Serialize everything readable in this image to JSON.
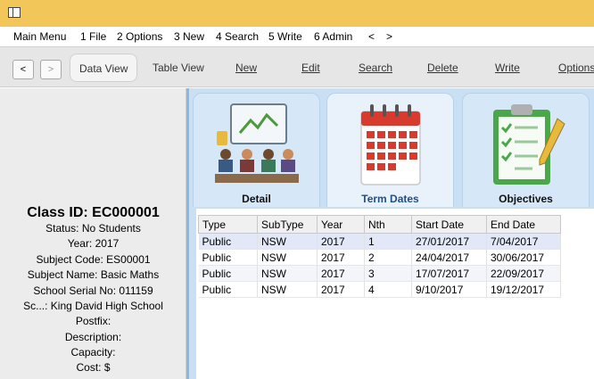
{
  "menu": {
    "items": [
      "Main Menu",
      "1 File",
      "2 Options",
      "3 New",
      "4 Search",
      "5 Write",
      "6 Admin",
      "<",
      ">"
    ]
  },
  "toolbar": {
    "back_label": "<",
    "forward_label": ">",
    "buttons": [
      "Data View",
      "Table View",
      "New",
      "Edit",
      "Search",
      "Delete",
      "Write",
      "Options"
    ]
  },
  "record": {
    "class_id": "Class ID: EC000001",
    "lines": [
      "Status: No Students",
      "Year: 2017",
      "Subject Code: ES00001",
      "Subject Name: Basic Maths",
      "School Serial No: 011159",
      "Sc...: King David High School",
      "Postfix:",
      "Description:",
      "Capacity:",
      "Cost: $"
    ]
  },
  "tiles": [
    {
      "label": "Detail",
      "icon": "presentation-icon"
    },
    {
      "label": "Term Dates",
      "icon": "calendar-icon"
    },
    {
      "label": "Objectives",
      "icon": "clipboard-checklist-icon"
    }
  ],
  "table": {
    "headers": [
      "Type",
      "SubType",
      "Year",
      "Nth",
      "Start Date",
      "End Date"
    ],
    "rows": [
      [
        "Public",
        "NSW",
        "2017",
        "1",
        "27/01/2017",
        "7/04/2017"
      ],
      [
        "Public",
        "NSW",
        "2017",
        "2",
        "24/04/2017",
        "30/06/2017"
      ],
      [
        "Public",
        "NSW",
        "2017",
        "3",
        "17/07/2017",
        "22/09/2017"
      ],
      [
        "Public",
        "NSW",
        "2017",
        "4",
        "9/10/2017",
        "19/12/2017"
      ]
    ]
  },
  "colors": {
    "titlebar": "#f3c65a",
    "panel_blue": "#c9dff3",
    "calendar_red": "#d83a2e",
    "clipboard_green": "#4aa84a"
  }
}
